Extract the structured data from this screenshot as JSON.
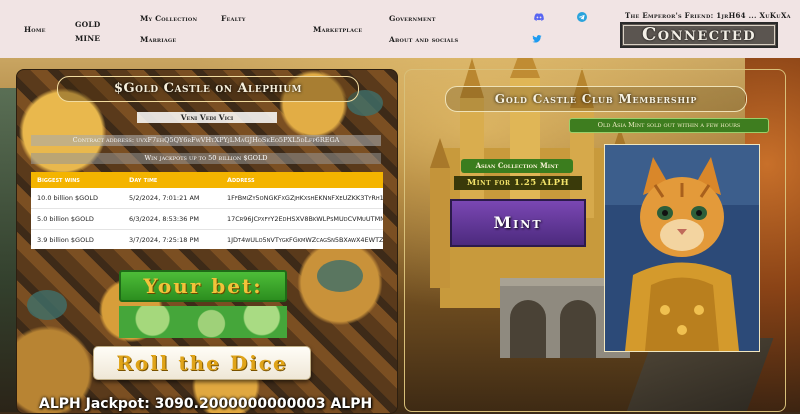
{
  "nav": {
    "home": "Home",
    "gold_mine": "GOLD\nMINE",
    "my_collection": "My Collection",
    "fealty": "Fealty",
    "marriage": "Marriage",
    "marketplace": "Marketplace",
    "government": "Government",
    "about": "About and socials"
  },
  "socials": [
    "discord-icon",
    "telegram-icon",
    "twitter-icon"
  ],
  "account": {
    "friend_label": "The Emperor's Friend: 1jrH64 ... XuKuXa",
    "connect_label": "Connected"
  },
  "left": {
    "title": "$Gold Castle on Alephium",
    "motto": "Veni Vedi Vici",
    "contract": "Contract address: uvxF7ehQ5QY6rFwVHtXPYjLMaGJHoSkEo5PXL5dLfp6REGA",
    "win_note": "Win jackpots up to 50 billion $GOLD",
    "table": {
      "headers": [
        "Biggest wins",
        "Day time",
        "Address"
      ],
      "rows": [
        [
          "10.0 billion $GOLD",
          "5/2/2024, 7:01:21 AM",
          "1FfBmiZy5oNGKFxGZjhKxshEKNnFXeUZKK3TyRh1CF3S"
        ],
        [
          "5.0 billion $GOLD",
          "6/3/2024, 8:53:36 PM",
          "17Cr96JCpxfyY2EdHSXV8BkWLPsMUdCVMuUTMMvmDFwP"
        ],
        [
          "3.9 billion $GOLD",
          "3/7/2024, 7:25:18 PM",
          "1JDt4wULo5nVTygkFGkmWZcagSn5BXawX4EWTZmfMFPq"
        ]
      ]
    },
    "bet_label": "Your bet:",
    "bet_value": "",
    "roll_label": "Roll the Dice",
    "jackpot": "ALPH Jackpot: 3090.2000000000003 ALPH"
  },
  "right": {
    "title": "Gold Castle Club Membership",
    "soldout": "Old Asia Mint sold out within a few hours",
    "mint_collection": "Asian Collection Mint",
    "mint_price": "Mint for 1.25 ALPH",
    "mint_label": "Mint"
  },
  "colors": {
    "nav_bg": "#f1e4e4",
    "table_header": "#f4b400",
    "bet_green": "#3aa12b",
    "mint_purple": "#6a3ca3",
    "gold_text": "#e0a419"
  }
}
